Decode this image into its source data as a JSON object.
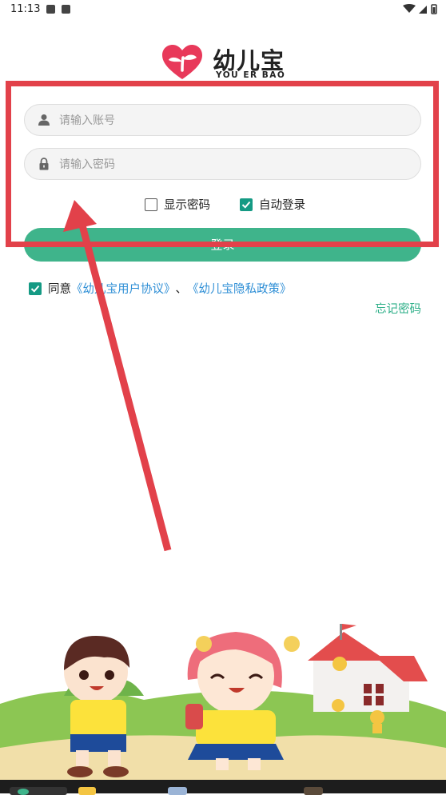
{
  "status_bar": {
    "time": "11:13"
  },
  "logo": {
    "name": "幼儿宝",
    "sub": "YOU ER BAO",
    "brand_color": "#e8395a"
  },
  "form": {
    "account_placeholder": "请输入账号",
    "password_placeholder": "请输入密码",
    "show_password_label": "显示密码",
    "show_password_checked": false,
    "auto_login_label": "自动登录",
    "auto_login_checked": true,
    "login_button": "登录"
  },
  "agreement": {
    "checked": true,
    "prefix": "同意",
    "user_agreement": "《幼儿宝用户协议》",
    "separator": "、",
    "privacy_policy": "《幼儿宝隐私政策》"
  },
  "forgot_password": "忘记密码",
  "colors": {
    "accent": "#3fb48b",
    "checkbox": "#159a84",
    "link": "#2f8fd6",
    "annotation": "#e2414a"
  }
}
